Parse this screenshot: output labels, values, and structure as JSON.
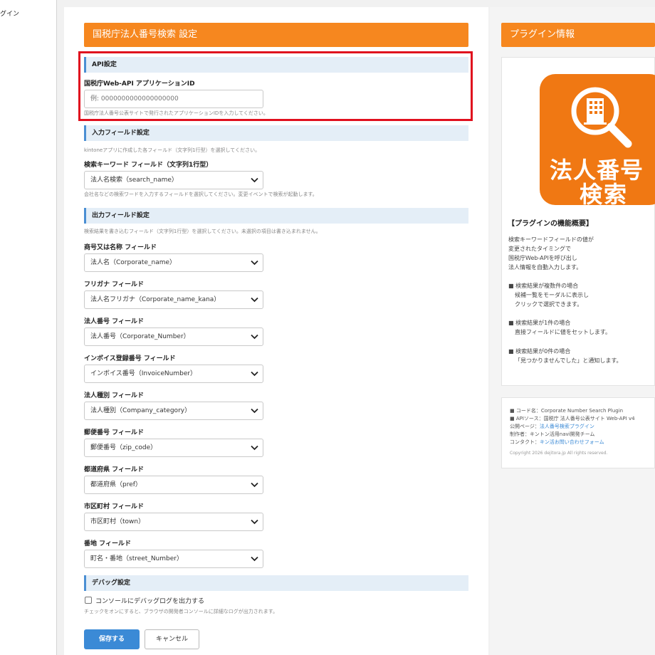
{
  "left_nav": {
    "label": "グイン"
  },
  "main": {
    "header_title": "国税庁法人番号検索 設定",
    "api_section": {
      "title": "API設定",
      "field_label": "国税庁Web-API アプリケーションID",
      "placeholder": "例: 0000000000000000000",
      "hint": "国税庁法人番号公表サイトで発行されたアプリケーションIDを入力してください。"
    },
    "input_section": {
      "title": "入力フィールド設定",
      "description": "kintoneアプリに作成した各フィールド（文字列1行型）を選択してください。",
      "field_label": "検索キーワード フィールド（文字列1行型）",
      "selected": "法人名検索（search_name）",
      "hint": "会社名などの検索ワードを入力するフィールドを選択してください。変更イベントで検索が起動します。"
    },
    "output_section": {
      "title": "出力フィールド設定",
      "description": "検索結果を書き込むフィールド（文字列1行型）を選択してください。未選択の項目は書き込まれません。",
      "fields": [
        {
          "label": "商号又は名称 フィールド",
          "selected": "法人名（Corporate_name）"
        },
        {
          "label": "フリガナ フィールド",
          "selected": "法人名フリガナ（Corporate_name_kana）"
        },
        {
          "label": "法人番号 フィールド",
          "selected": "法人番号（Corporate_Number）"
        },
        {
          "label": "インボイス登録番号 フィールド",
          "selected": "インボイス番号（InvoiceNumber）"
        },
        {
          "label": "法人種別 フィールド",
          "selected": "法人種別（Company_category）"
        },
        {
          "label": "郵便番号 フィールド",
          "selected": "郵便番号（zip_code）"
        },
        {
          "label": "都道府県 フィールド",
          "selected": "都道府県（pref）"
        },
        {
          "label": "市区町村 フィールド",
          "selected": "市区町村（town）"
        },
        {
          "label": "番地 フィールド",
          "selected": "町名・番地（street_Number）"
        }
      ]
    },
    "debug_section": {
      "title": "デバッグ設定",
      "checkbox_label": "コンソールにデバッグログを出力する",
      "checked": false,
      "hint": "チェックをオンにすると、ブラウザの開発者コンソールに詳細なログが出力されます。"
    },
    "buttons": {
      "save": "保存する",
      "cancel": "キャンセル"
    }
  },
  "side": {
    "header_title": "プラグイン情報",
    "logo": {
      "title": "法人番号",
      "subtitle": "検索"
    },
    "summary_heading": "【プラグインの機能概要】",
    "summary_lines": [
      "検索キーワードフィールドの値が",
      "変更されたタイミングで",
      "国税庁Web-APIを呼び出し",
      "法人情報を自動入力します。"
    ],
    "cases": [
      {
        "title": "■ 検索結果が複数件の場合",
        "lines": [
          "候補一覧をモーダルに表示し",
          "クリックで選択できます。"
        ]
      },
      {
        "title": "■ 検索結果が1件の場合",
        "lines": [
          "直接フィールドに値をセットします。"
        ]
      },
      {
        "title": "■ 検索結果が0件の場合",
        "lines": [
          "「見つかりませんでした」と通知します。"
        ]
      }
    ],
    "info": {
      "code_name": "■ コード名：Corporate Number Search Plugin",
      "api_source": "■ APIソース：国税庁 法人番号公表サイト Web-API v4",
      "public_page_label": "公開ページ：",
      "public_page_link": "法人番号検索プラグイン",
      "author": "制作者：キントン活用navi開発チーム",
      "contact_label": "コンタクト：",
      "contact_link": "キン活お問い合わせフォーム",
      "copyright": "Copyright 2026 dejitora.jp All rights reserved."
    }
  },
  "colors": {
    "accent_orange": "#f6871f",
    "primary_blue": "#3b8ad6",
    "highlight_red": "#e0101e"
  }
}
